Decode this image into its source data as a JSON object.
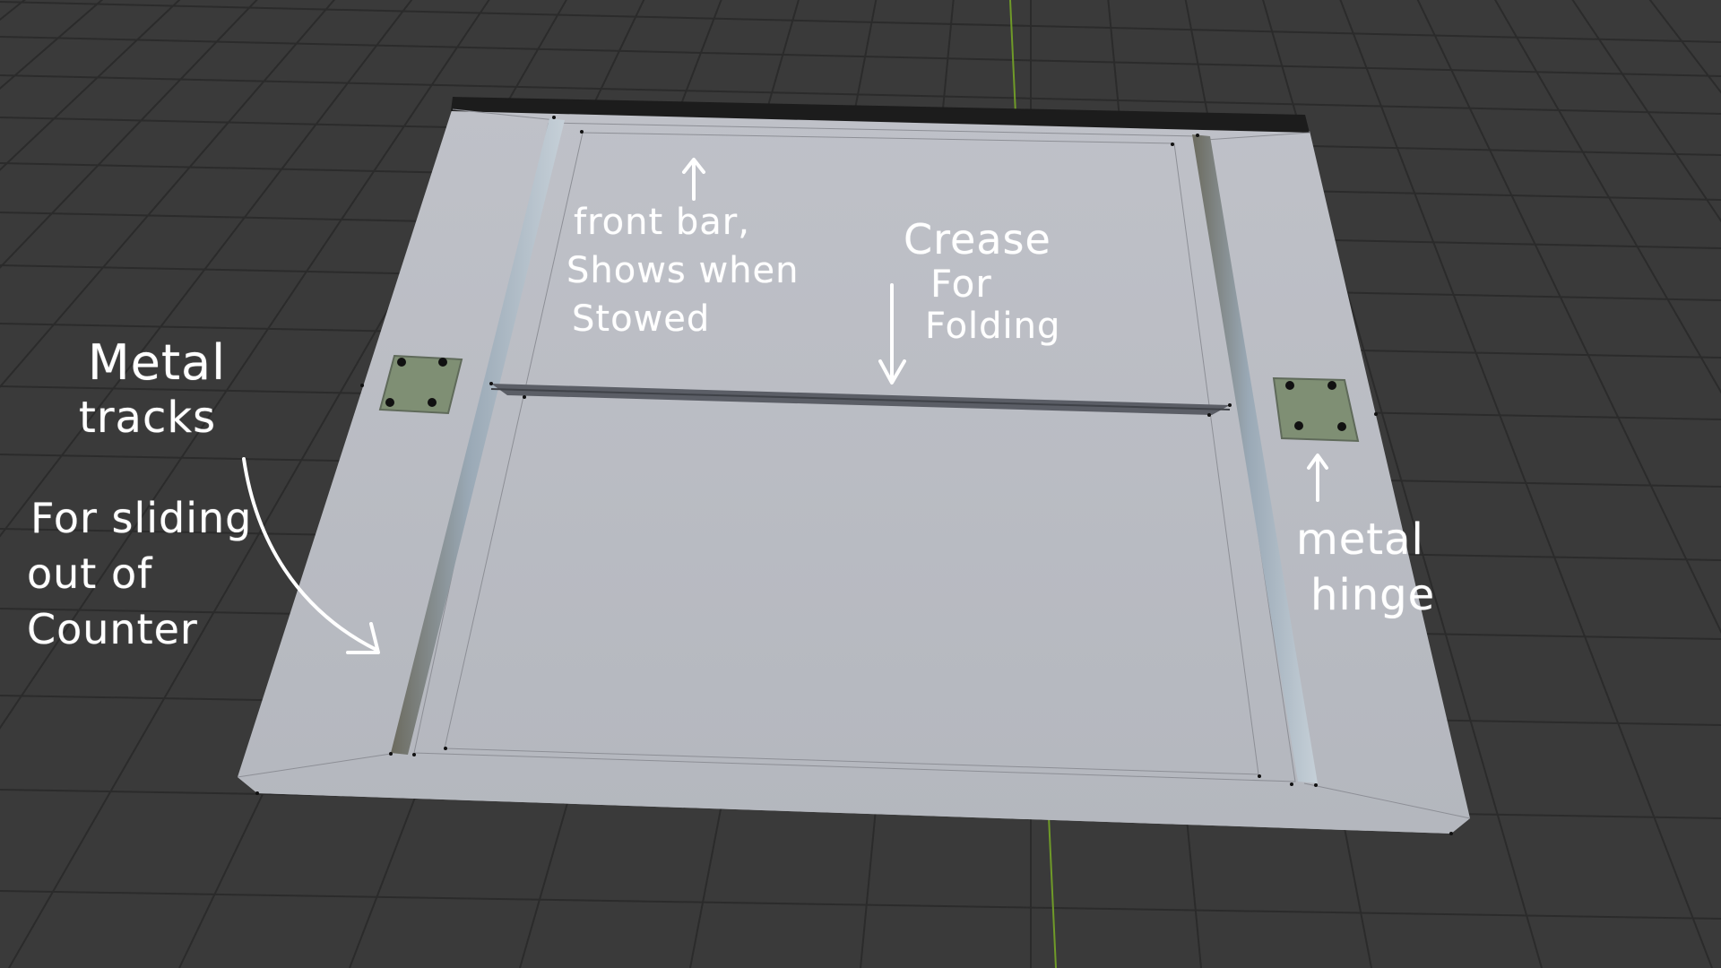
{
  "viewport": {
    "name": "3D viewport",
    "colors": {
      "background": "#3a3a3a",
      "grid_line": "#2b2b2b",
      "y_axis": "#6f9a28",
      "panel_top": "#b9bcc4",
      "panel_top_light": "#c3c5cc",
      "panel_edge": "#a9aab0",
      "front_bar": "#1c1c1c",
      "crease": "#5b5e66",
      "track_metal": "#8c9aa6",
      "track_dark": "#6b6a5e",
      "hinge": "#7f8f74",
      "hinge_border": "#5f6a5a",
      "annotation": "#ffffff"
    }
  },
  "annotations": {
    "front_bar": [
      "front bar,",
      "Shows when",
      "Stowed"
    ],
    "crease": [
      "Crease",
      "For",
      "Folding"
    ],
    "metal_tracks": [
      "Metal",
      "tracks"
    ],
    "sliding": [
      "For sliding",
      "out of",
      "Counter"
    ],
    "metal_hinge": [
      "metal",
      "hinge"
    ]
  },
  "icons": {
    "arrow_up_front_bar": "arrow-up-icon",
    "arrow_down_crease": "arrow-down-icon",
    "arrow_curved_tracks": "curved-arrow-icon",
    "arrow_up_hinge": "arrow-up-icon"
  }
}
